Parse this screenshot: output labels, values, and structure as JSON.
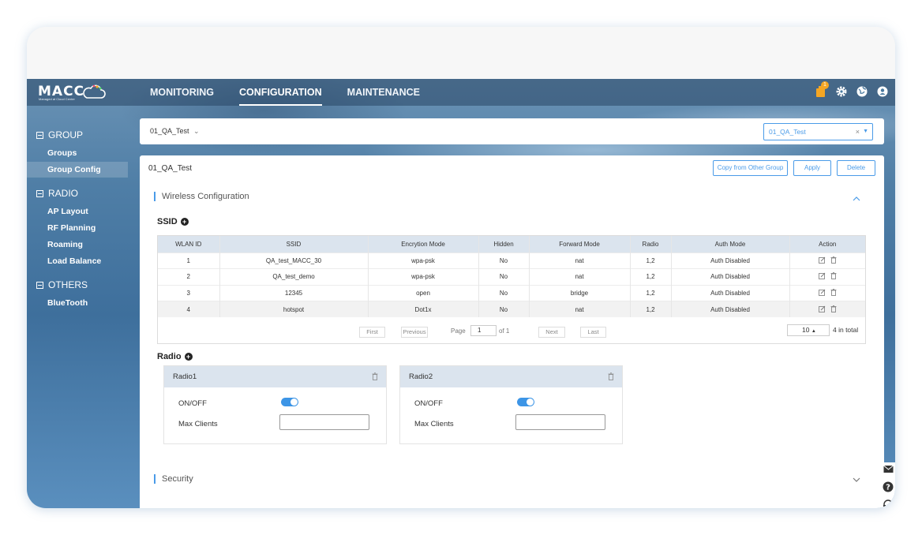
{
  "logo": {
    "text": "MACC",
    "subtitle": "Managed at Cloud Center"
  },
  "nav": {
    "items": [
      {
        "label": "MONITORING",
        "active": false
      },
      {
        "label": "CONFIGURATION",
        "active": true
      },
      {
        "label": "MAINTENANCE",
        "active": false
      }
    ]
  },
  "topbar": {
    "notification_count": "1",
    "icons": [
      "notification-icon",
      "gear-icon",
      "globe-icon",
      "user-icon"
    ]
  },
  "sidebar": {
    "groups": [
      {
        "label": "GROUP",
        "items": [
          "Groups",
          "Group Config"
        ]
      },
      {
        "label": "RADIO",
        "items": [
          "AP Layout",
          "RF Planning",
          "Roaming",
          "Load Balance"
        ]
      },
      {
        "label": "OTHERS",
        "items": [
          "BlueTooth"
        ]
      }
    ],
    "active_item": "Group Config"
  },
  "selector": {
    "left_value": "01_QA_Test",
    "right_value": "01_QA_Test"
  },
  "panel": {
    "title": "01_QA_Test",
    "buttons": {
      "copy": "Copy from Other Group",
      "apply": "Apply",
      "delete": "Delete"
    },
    "wireless_section": "Wireless Configuration",
    "security_section": "Security"
  },
  "ssid": {
    "heading": "SSID",
    "columns": [
      "WLAN ID",
      "SSID",
      "Encrytion Mode",
      "Hidden",
      "Forward Mode",
      "Radio",
      "Auth Mode",
      "Action"
    ],
    "rows": [
      [
        "1",
        "QA_test_MACC_30",
        "wpa-psk",
        "No",
        "nat",
        "1,2",
        "Auth Disabled"
      ],
      [
        "2",
        "QA_test_demo",
        "wpa-psk",
        "No",
        "nat",
        "1,2",
        "Auth Disabled"
      ],
      [
        "3",
        "12345",
        "open",
        "No",
        "bridge",
        "1,2",
        "Auth Disabled"
      ],
      [
        "4",
        "hotspot",
        "Dot1x",
        "No",
        "nat",
        "1,2",
        "Auth Disabled"
      ]
    ],
    "pager": {
      "first": "First",
      "previous": "Previous",
      "page_label": "Page",
      "page_value": "1",
      "of": "of 1",
      "next": "Next",
      "last": "Last",
      "page_size": "10",
      "total": "4 in total"
    }
  },
  "radio": {
    "heading": "Radio",
    "cards": [
      {
        "title": "Radio1",
        "onoff_label": "ON/OFF",
        "onoff": true,
        "max_clients_label": "Max Clients",
        "max_clients_value": ""
      },
      {
        "title": "Radio2",
        "onoff_label": "ON/OFF",
        "onoff": true,
        "max_clients_label": "Max Clients",
        "max_clients_value": ""
      }
    ]
  },
  "side_float_icons": [
    "mail-icon",
    "help-icon",
    "headset-icon"
  ]
}
